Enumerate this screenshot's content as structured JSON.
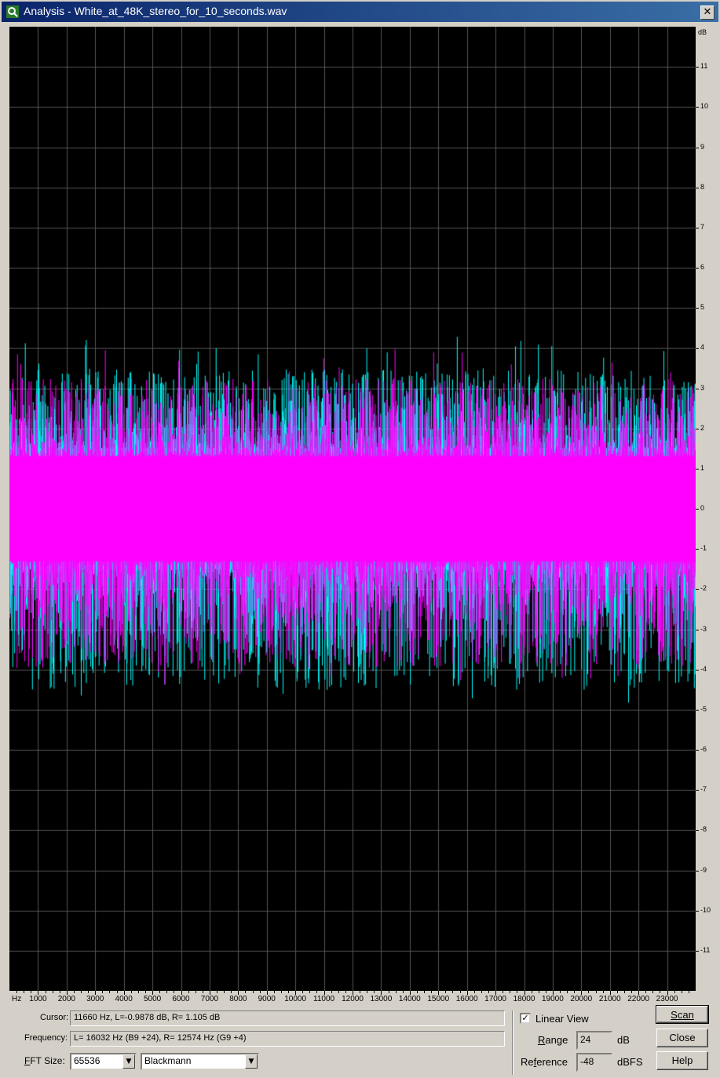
{
  "window": {
    "title": "Analysis - White_at_48K_stereo_for_10_seconds.wav",
    "close_glyph": "✕"
  },
  "chart_data": {
    "type": "line",
    "xlabel": "Hz",
    "ylabel": "dB",
    "xlim": [
      0,
      24000
    ],
    "ylim": [
      -12,
      12
    ],
    "x_ticks": [
      "1000",
      "2000",
      "3000",
      "4000",
      "5000",
      "6000",
      "7000",
      "8000",
      "9000",
      "10000",
      "11000",
      "12000",
      "13000",
      "14000",
      "15000",
      "16000",
      "17000",
      "18000",
      "19000",
      "20000",
      "21000",
      "22000",
      "23000"
    ],
    "y_ticks": [
      "11",
      "10",
      "9",
      "8",
      "7",
      "6",
      "5",
      "4",
      "3",
      "2",
      "1",
      "0",
      "-1",
      "-2",
      "-3",
      "-4",
      "-5",
      "-6",
      "-7",
      "-8",
      "-9",
      "-10",
      "-11"
    ],
    "grid": true,
    "background": "#000000",
    "series": [
      {
        "color": "#00ffff",
        "band_low": -1.5,
        "band_high": 1.5,
        "peak_max": 4.3,
        "peak_min": -5.0
      },
      {
        "color": "#ff00ff",
        "band_low": -1.3,
        "band_high": 1.3,
        "peak_max": 4.0,
        "peak_min": -4.4
      }
    ]
  },
  "readouts": {
    "cursor_label": "Cursor:",
    "cursor_value": "11660 Hz, L=-0.9878 dB, R= 1.105 dB",
    "frequency_label": "Frequency:",
    "frequency_value": "L=  16032 Hz (B9 +24), R=  12574 Hz (G9 +4)"
  },
  "fft": {
    "size_label_mn": "F",
    "size_label_rest": "FT Size:",
    "size_value": "65536",
    "window_value": "Blackmann"
  },
  "options": {
    "linear_view_checked": true,
    "linear_view_label": "Linear View",
    "range_label_mn": "R",
    "range_label_rest": "ange",
    "range_value": "24",
    "range_unit": "dB",
    "reference_label_pre": "Re",
    "reference_label_mn": "f",
    "reference_label_rest": "erence",
    "reference_value": "-48",
    "reference_unit": "dBFS"
  },
  "buttons": {
    "scan": "Scan",
    "close": "Close",
    "help": "Help"
  }
}
